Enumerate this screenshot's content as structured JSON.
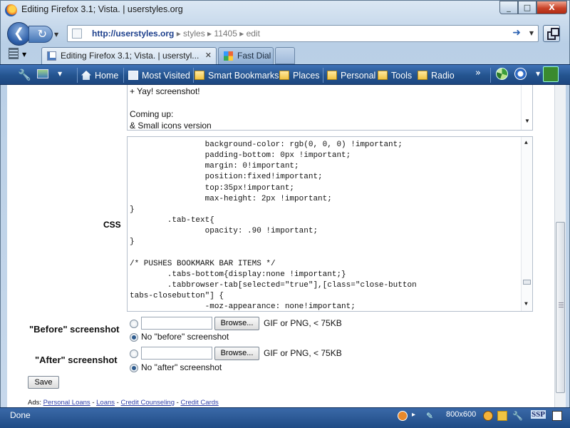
{
  "window": {
    "title": "Editing Firefox 3.1; Vista. | userstyles.org",
    "minimize_glyph": "_",
    "maximize_glyph": "□",
    "close_glyph": "X"
  },
  "nav": {
    "back_glyph": "❮",
    "reload_glyph": "↻",
    "url_host": "http://userstyles.org",
    "url_path": " ▸ styles ▸ 11405 ▸ edit",
    "go_glyph": "➜"
  },
  "tabs": [
    {
      "label": "Editing Firefox 3.1; Vista. | userstyl...",
      "close": "✕"
    },
    {
      "label": "Fast Dial"
    }
  ],
  "bookmarks": [
    {
      "label": "Home"
    },
    {
      "label": "Most Visited"
    },
    {
      "label": "Smart Bookmarks"
    },
    {
      "label": "Places"
    },
    {
      "label": "Personal"
    },
    {
      "label": "Tools"
    },
    {
      "label": "Radio"
    }
  ],
  "bookmarks_overflow": "»",
  "description": {
    "lines": [
      "+ Yay! screenshot!",
      "",
      "Coming up:",
      "& Small icons version"
    ]
  },
  "css": {
    "label": "CSS",
    "code": "                background-color: rgb(0, 0, 0) !important;\n                padding-bottom: 0px !important;\n                margin: 0!important;\n                position:fixed!important;\n                top:35px!important;\n                max-height: 2px !important;\n}\n        .tab-text{\n                opacity: .90 !important;\n}\n\n/* PUSHES BOOKMARK BAR ITEMS */\n        .tabs-bottom{display:none !important;}\n        .tabbrowser-tab[selected=\"true\"],[class=\"close-button\ntabs-closebutton\"] {\n                -moz-appearance: none!important;"
  },
  "before": {
    "label": "\"Before\" screenshot",
    "browse": "Browse...",
    "hint": "GIF or PNG, < 75KB",
    "none_label": "No \"before\" screenshot"
  },
  "after": {
    "label": "\"After\" screenshot",
    "browse": "Browse...",
    "hint": "GIF or PNG, < 75KB",
    "none_label": "No \"after\" screenshot"
  },
  "save_label": "Save",
  "ads": {
    "prefix": "Ads: ",
    "links": [
      "Personal Loans",
      "Loans",
      "Credit Counseling",
      "Credit Cards"
    ],
    "separator": " - "
  },
  "status": {
    "text": "Done",
    "resolution": "800x600",
    "ssp": "SSP"
  },
  "colors": {
    "bookmark_bar": "#24548f",
    "link": "#2f3fa8",
    "status_bar": "#1f4b85"
  }
}
